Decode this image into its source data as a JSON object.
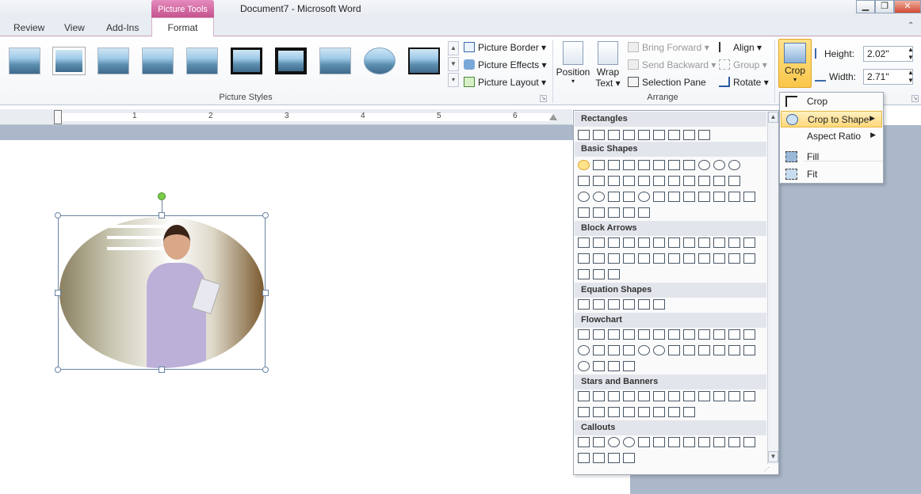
{
  "window": {
    "title": "Document7 - Microsoft Word",
    "context_tab": "Picture Tools"
  },
  "tabs": [
    "Review",
    "View",
    "Add-Ins"
  ],
  "active_tab": "Format",
  "picture_styles": {
    "group_label": "Picture Styles",
    "border_label": "Picture Border",
    "effects_label": "Picture Effects",
    "layout_label": "Picture Layout"
  },
  "arrange": {
    "group_label": "Arrange",
    "position_label": "Position",
    "wrap_label_1": "Wrap",
    "wrap_label_2": "Text",
    "bring_forward": "Bring Forward",
    "send_backward": "Send Backward",
    "selection_pane": "Selection Pane",
    "align": "Align",
    "group": "Group",
    "rotate": "Rotate"
  },
  "size": {
    "crop_label": "Crop",
    "height_label": "Height:",
    "height_value": "2.02\"",
    "width_label": "Width:",
    "width_value": "2.71\""
  },
  "ruler_numbers": [
    "1",
    "2",
    "3",
    "4",
    "5",
    "6"
  ],
  "crop_menu": {
    "items": [
      "Crop",
      "Crop to Shape",
      "Aspect Ratio",
      "Fill",
      "Fit"
    ]
  },
  "shapes_panel": {
    "sections": [
      "Rectangles",
      "Basic Shapes",
      "Block Arrows",
      "Equation Shapes",
      "Flowchart",
      "Stars and Banners",
      "Callouts"
    ]
  },
  "colors": {
    "context_tab_pink": "#c5528f",
    "menu_highlight": "#ffd87a",
    "crop_button": "#f9c64a",
    "page_background": "#abb8c9",
    "rotate_handle": "#7ccc4a"
  }
}
